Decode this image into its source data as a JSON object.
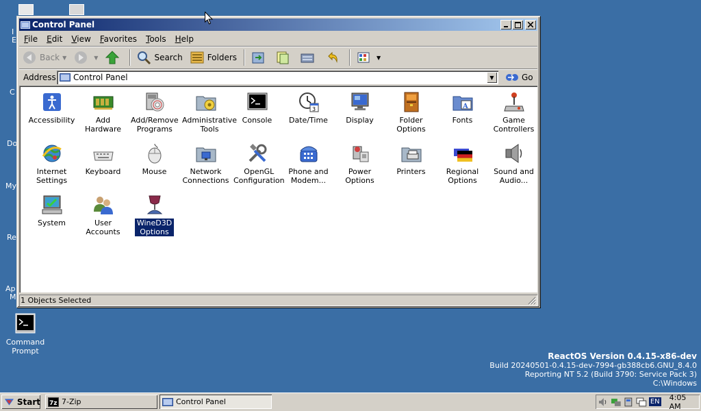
{
  "window": {
    "title": "Control Panel",
    "menu": [
      {
        "key": "F",
        "rest": "ile"
      },
      {
        "key": "E",
        "rest": "dit"
      },
      {
        "key": "V",
        "rest": "iew"
      },
      {
        "key": "F",
        "rest": "avorites"
      },
      {
        "key": "T",
        "rest": "ools"
      },
      {
        "key": "H",
        "rest": "elp"
      }
    ],
    "toolbar": {
      "back": "Back",
      "search": "Search",
      "folders": "Folders"
    },
    "address": {
      "label": "Address",
      "value": "Control Panel",
      "go": "Go"
    },
    "items": [
      {
        "label": "Accessibility",
        "icon": "accessibility-icon"
      },
      {
        "label": "Add\nHardware",
        "icon": "add-hardware-icon"
      },
      {
        "label": "Add/Remove\nPrograms",
        "icon": "add-remove-programs-icon"
      },
      {
        "label": "Administrative\nTools",
        "icon": "administrative-tools-icon"
      },
      {
        "label": "Console",
        "icon": "console-icon"
      },
      {
        "label": "Date/Time",
        "icon": "date-time-icon"
      },
      {
        "label": "Display",
        "icon": "display-icon"
      },
      {
        "label": "Folder\nOptions",
        "icon": "folder-options-icon"
      },
      {
        "label": "Fonts",
        "icon": "fonts-icon"
      },
      {
        "label": "Game\nControllers",
        "icon": "game-controllers-icon"
      },
      {
        "label": "Internet\nSettings",
        "icon": "internet-settings-icon"
      },
      {
        "label": "Keyboard",
        "icon": "keyboard-icon"
      },
      {
        "label": "Mouse",
        "icon": "mouse-icon"
      },
      {
        "label": "Network\nConnections",
        "icon": "network-connections-icon"
      },
      {
        "label": "OpenGL\nConfiguration",
        "icon": "opengl-configuration-icon"
      },
      {
        "label": "Phone and\nModem...",
        "icon": "phone-modem-icon"
      },
      {
        "label": "Power\nOptions",
        "icon": "power-options-icon"
      },
      {
        "label": "Printers",
        "icon": "printers-icon"
      },
      {
        "label": "Regional\nOptions",
        "icon": "regional-options-icon"
      },
      {
        "label": "Sound and\nAudio...",
        "icon": "sound-audio-icon"
      },
      {
        "label": "System",
        "icon": "system-icon"
      },
      {
        "label": "User\nAccounts",
        "icon": "user-accounts-icon"
      },
      {
        "label": "WineD3D\nOptions",
        "icon": "wined3d-options-icon",
        "selected": true
      }
    ],
    "status": "1 Objects Selected"
  },
  "desktop": {
    "command_prompt": "Command\nPrompt",
    "partial_labels": [
      "I",
      "E",
      "C",
      "Do",
      "My",
      "Re",
      "Ap",
      "M"
    ]
  },
  "version": {
    "line1": "ReactOS Version 0.4.15-x86-dev",
    "line2": "Build 20240501-0.4.15-dev-7994-gb388cb6.GNU_8.4.0",
    "line3": "Reporting NT 5.2 (Build 3790: Service Pack 3)",
    "line4": "C:\\Windows"
  },
  "taskbar": {
    "start": "Start",
    "tasks": [
      "7-Zip",
      "Control Panel"
    ],
    "language": "EN",
    "clock": "4:05 AM"
  },
  "colors": {
    "desktop": "#3a6ea5",
    "title_active": "#0a246a",
    "face": "#d4d0c8",
    "selection": "#0a246a"
  }
}
